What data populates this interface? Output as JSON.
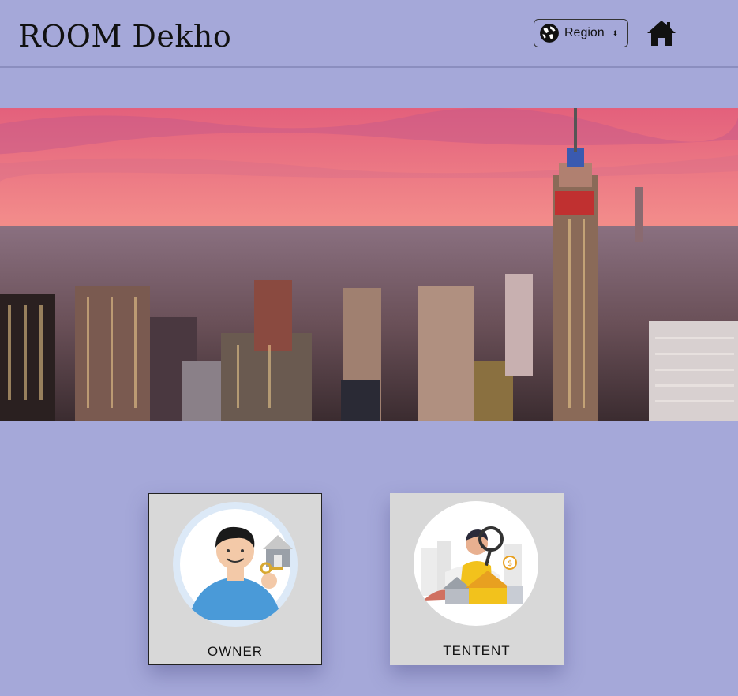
{
  "header": {
    "brand": "ROOM Dekho",
    "region_label": "Region",
    "region_icon": "globe-icon",
    "home_icon": "home-icon"
  },
  "hero": {
    "description": ""
  },
  "cards": [
    {
      "label": "OWNER",
      "icon": "owner-illustration"
    },
    {
      "label": "TENTENT",
      "icon": "tenant-illustration"
    }
  ],
  "colors": {
    "background": "#a5a8d9",
    "card": "#d8d8d8",
    "sky_top": "#f27a98",
    "sky_bottom": "#f49a6b"
  }
}
